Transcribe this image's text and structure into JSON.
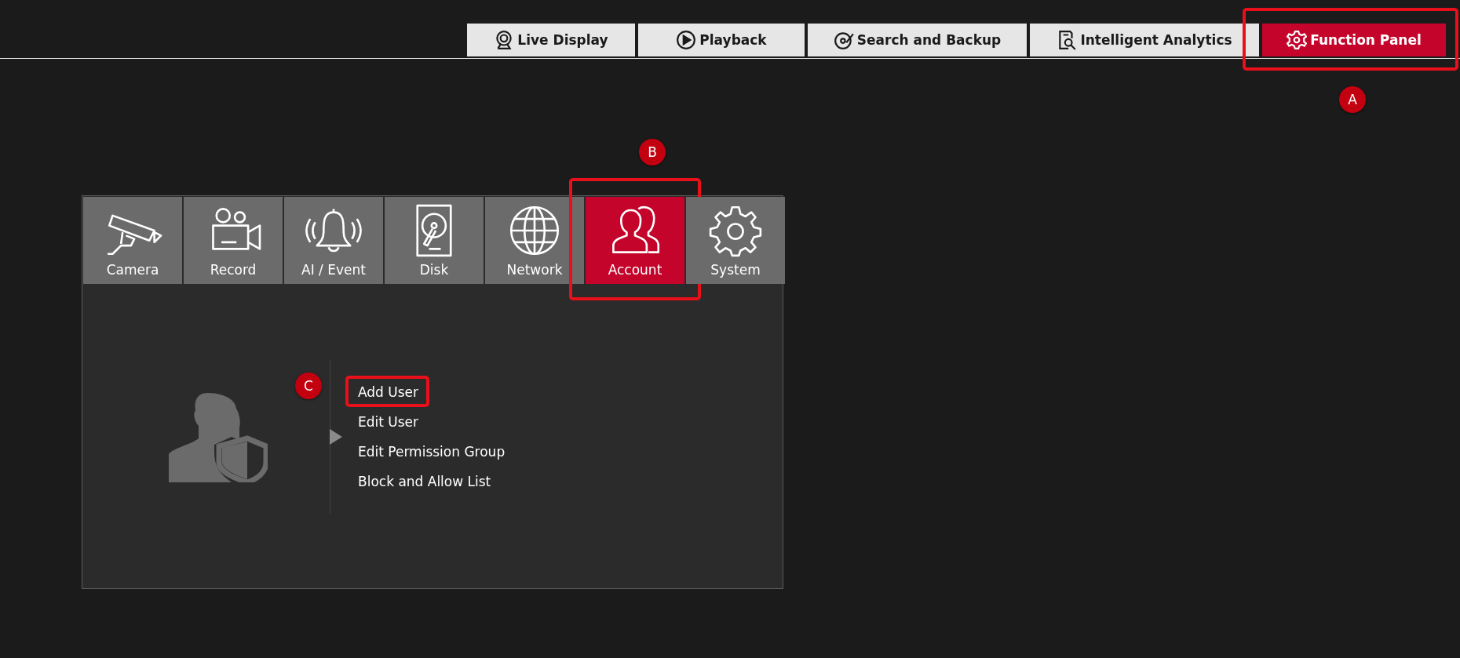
{
  "top_tabs": [
    {
      "label": "Live Display",
      "selected": false
    },
    {
      "label": "Playback",
      "selected": false
    },
    {
      "label": "Search and Backup",
      "selected": false
    },
    {
      "label": "Intelligent Analytics",
      "selected": false
    },
    {
      "label": "Function Panel",
      "selected": true,
      "callout": "A"
    }
  ],
  "panel": {
    "tabs": [
      {
        "label": "Camera",
        "selected": false
      },
      {
        "label": "Record",
        "selected": false
      },
      {
        "label": "AI / Event",
        "selected": false
      },
      {
        "label": "Disk",
        "selected": false
      },
      {
        "label": "Network",
        "selected": false
      },
      {
        "label": "Account",
        "selected": true,
        "callout": "B"
      },
      {
        "label": "System",
        "selected": false
      }
    ],
    "menu": [
      {
        "label": "Add User",
        "callout": "C"
      },
      {
        "label": "Edit User"
      },
      {
        "label": "Edit Permission Group"
      },
      {
        "label": "Block and Allow List"
      }
    ]
  }
}
